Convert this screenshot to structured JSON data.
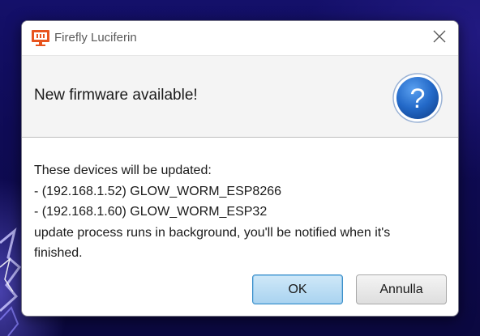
{
  "window": {
    "title": "Firefly Luciferin",
    "app_icon": "luciferin-monitor-icon",
    "close_icon": "close-icon"
  },
  "header": {
    "text": "New firmware available!",
    "icon": "question-icon"
  },
  "message": {
    "lines": [
      "These devices will be updated:",
      "- (192.168.1.52) GLOW_WORM_ESP8266",
      "- (192.168.1.60) GLOW_WORM_ESP32",
      "update process runs in background, you'll be notified when it's",
      "finished."
    ]
  },
  "buttons": {
    "ok_label": "OK",
    "cancel_label": "Annulla"
  },
  "colors": {
    "accent": "#3c8fc9",
    "app_icon": "#e8541e",
    "question_icon": "#1f63c2",
    "wallpaper": "#0d0a45"
  }
}
